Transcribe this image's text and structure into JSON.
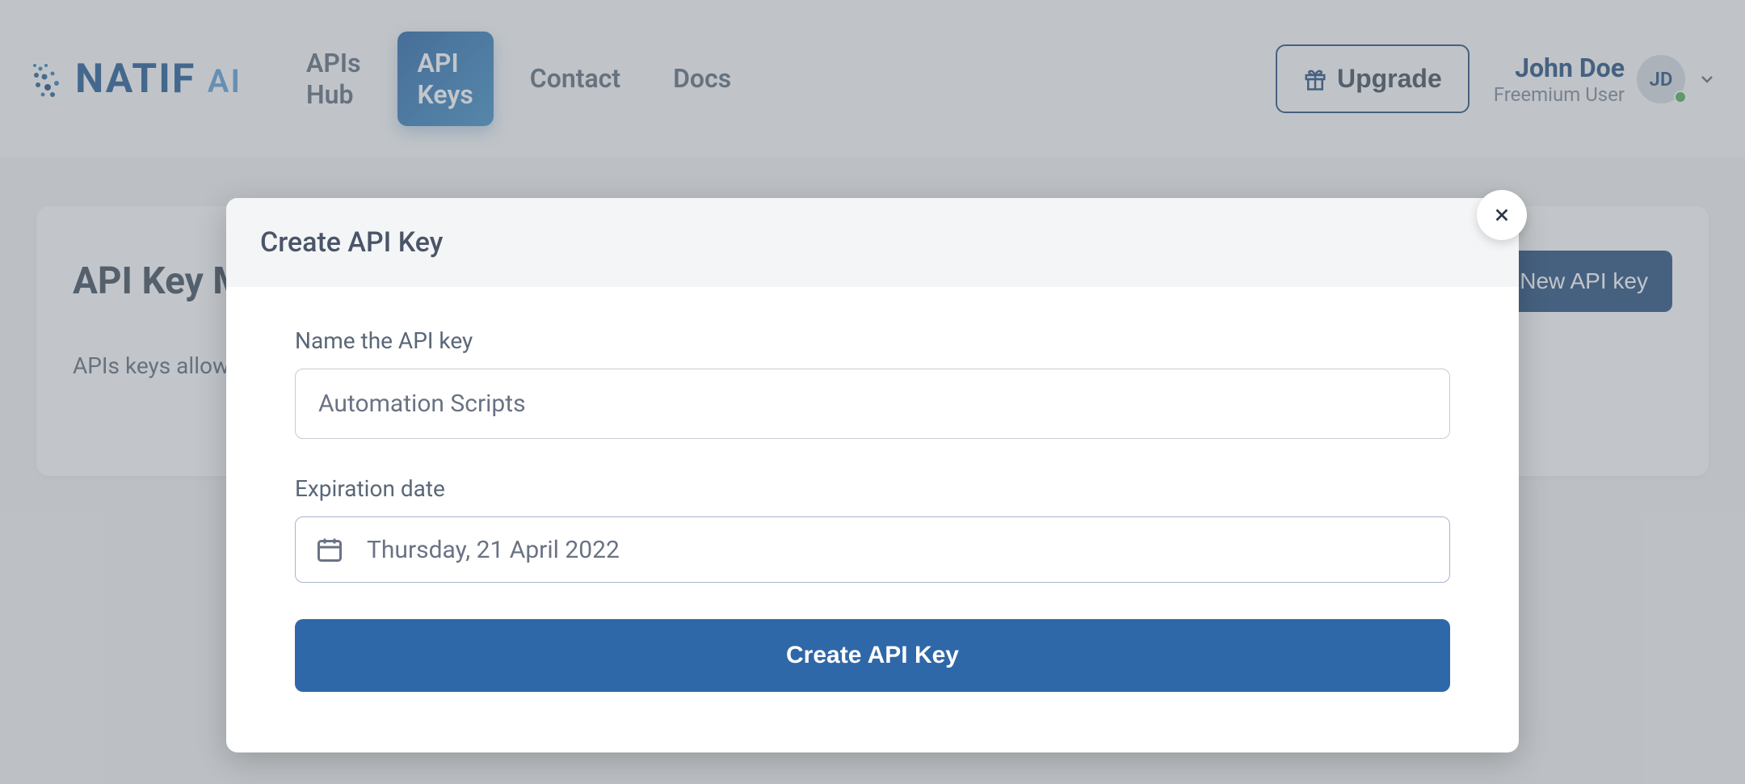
{
  "header": {
    "logo_text_1": "NATIF",
    "logo_text_2": "AI",
    "nav": [
      {
        "label": "APIs\nHub"
      },
      {
        "label": "API\nKeys"
      },
      {
        "label": "Contact"
      },
      {
        "label": "Docs"
      }
    ],
    "upgrade_label": "Upgrade",
    "user": {
      "name": "John Doe",
      "role": "Freemium User",
      "initials": "JD"
    }
  },
  "main": {
    "title": "API Key Management",
    "new_key_label": "+ New API key",
    "desc": "APIs keys allow you to connect with different integrations."
  },
  "modal": {
    "title": "Create API Key",
    "name_label": "Name the API key",
    "name_value": "Automation Scripts",
    "date_label": "Expiration date",
    "date_value": "Thursday, 21 April 2022",
    "submit_label": "Create API Key"
  }
}
